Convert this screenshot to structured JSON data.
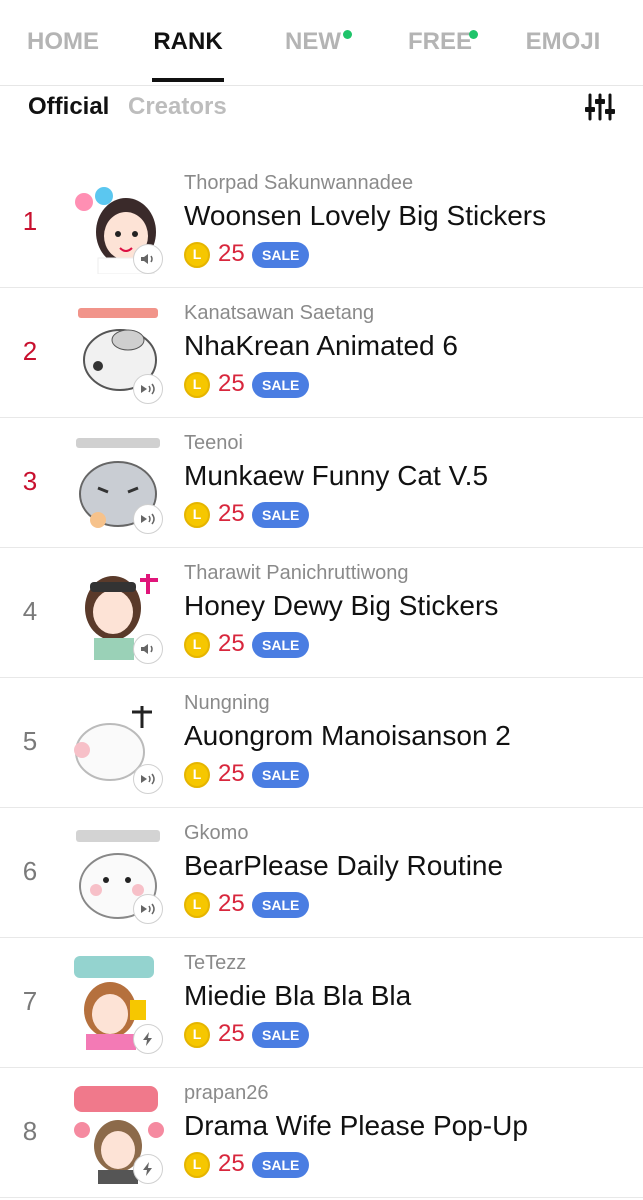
{
  "nav": {
    "tabs": [
      {
        "label": "HOME",
        "active": false,
        "dot": false
      },
      {
        "label": "RANK",
        "active": true,
        "dot": false
      },
      {
        "label": "NEW",
        "active": false,
        "dot": true
      },
      {
        "label": "FREE",
        "active": false,
        "dot": true
      },
      {
        "label": "EMOJI",
        "active": false,
        "dot": false
      }
    ],
    "dot_color": "#1fc46a"
  },
  "subnav": {
    "official": "Official",
    "creators": "Creators",
    "filter_icon": "sliders-icon"
  },
  "items": [
    {
      "rank": "1",
      "author": "Thorpad Sakunwannadee",
      "title": "Woonsen Lovely Big Stickers",
      "price": "25",
      "badge": "SALE",
      "icon": "sound-icon"
    },
    {
      "rank": "2",
      "author": "Kanatsawan Saetang",
      "title": "NhaKrean Animated 6",
      "price": "25",
      "badge": "SALE",
      "icon": "animation-sound-icon"
    },
    {
      "rank": "3",
      "author": "Teenoi",
      "title": "Munkaew Funny Cat V.5",
      "price": "25",
      "badge": "SALE",
      "icon": "animation-sound-icon"
    },
    {
      "rank": "4",
      "author": "Tharawit Panichruttiwong",
      "title": "Honey Dewy Big Stickers",
      "price": "25",
      "badge": "SALE",
      "icon": "sound-icon"
    },
    {
      "rank": "5",
      "author": "Nungning",
      "title": "Auongrom Manoisanson 2",
      "price": "25",
      "badge": "SALE",
      "icon": "animation-sound-icon"
    },
    {
      "rank": "6",
      "author": "Gkomo",
      "title": "BearPlease Daily Routine",
      "price": "25",
      "badge": "SALE",
      "icon": "animation-sound-icon"
    },
    {
      "rank": "7",
      "author": "TeTezz",
      "title": "Miedie Bla Bla Bla",
      "price": "25",
      "badge": "SALE",
      "icon": "popup-icon"
    },
    {
      "rank": "8",
      "author": "prapan26",
      "title": "Drama Wife Please Pop-Up",
      "price": "25",
      "badge": "SALE",
      "icon": "popup-icon"
    }
  ],
  "colors": {
    "top_rank": "#c8102e",
    "rank": "#7a7a7a",
    "price": "#d8263c",
    "sale_badge": "#4a7de2",
    "coin": "#f6c700"
  }
}
